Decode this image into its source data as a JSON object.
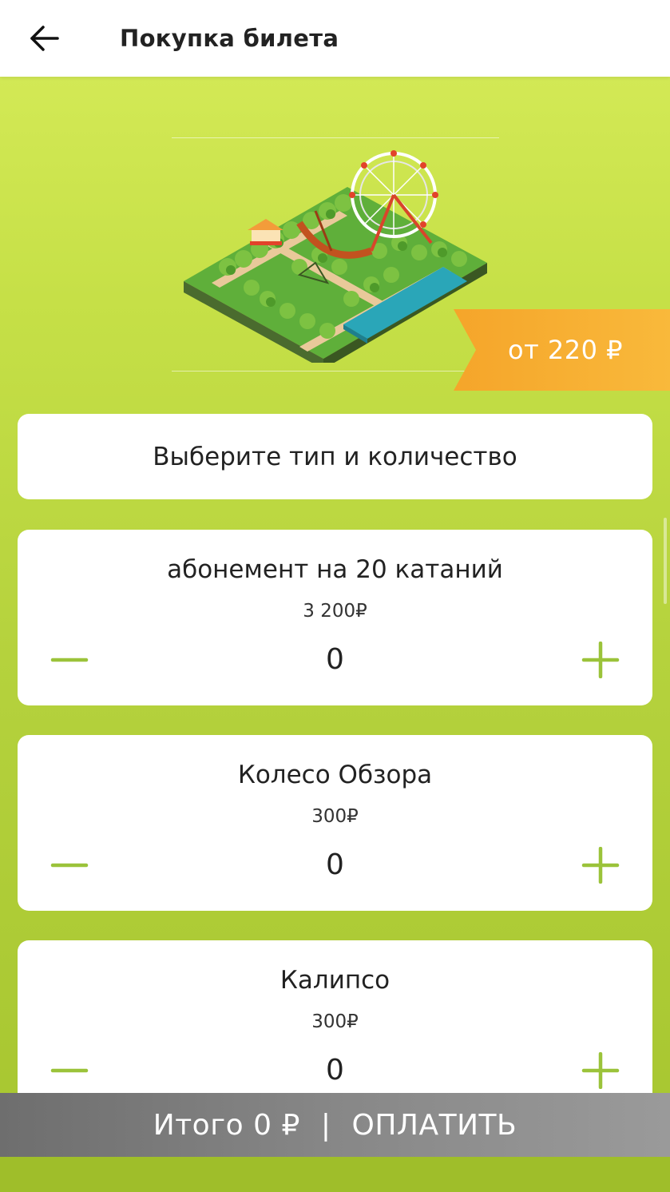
{
  "header": {
    "title": "Покупка билета",
    "back_icon": "arrow-left-icon"
  },
  "hero": {
    "illustration": "amusement-park-illustration",
    "price_from": "от 220 ₽",
    "ribbon_color": "#f6a024"
  },
  "choose": {
    "label": "Выберите тип и количество"
  },
  "tickets": [
    {
      "name": "абонемент на 20 катаний",
      "price": "3 200₽",
      "quantity": "0"
    },
    {
      "name": "Колесо Обзора",
      "price": "300₽",
      "quantity": "0"
    },
    {
      "name": "Калипсо",
      "price": "300₽",
      "quantity": "0"
    }
  ],
  "paybar": {
    "total": "Итого 0 ₽",
    "separator": "|",
    "action": "ОПЛАТИТЬ"
  },
  "colors": {
    "accent_green": "#9bc33a",
    "background_top": "#d7ec5a",
    "background_bottom": "#a6c52f",
    "ribbon_orange": "#f6a024",
    "paybar_gray": "#7a7a7a"
  }
}
